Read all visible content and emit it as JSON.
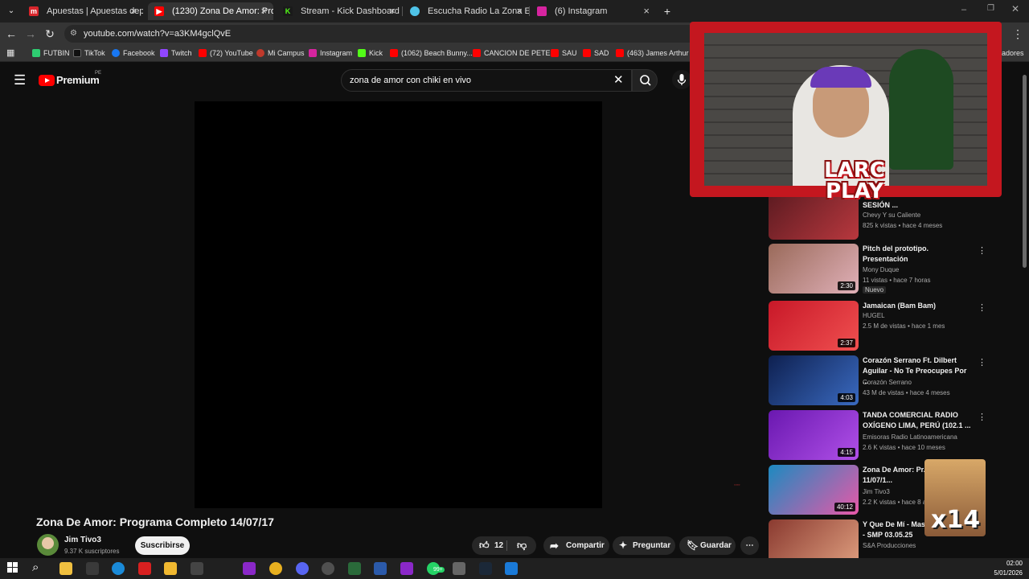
{
  "browser": {
    "tabs": [
      {
        "title": "Apuestas | Apuestas deportivas",
        "active": false,
        "icon": "m-icon"
      },
      {
        "title": "(1230) Zona De Amor: Prog",
        "active": true,
        "icon": "youtube-icon"
      },
      {
        "title": "Stream - Kick Dashboard",
        "active": false,
        "icon": "kick-icon"
      },
      {
        "title": "Escucha Radio La Zona EN VIVO",
        "active": false,
        "icon": "radio-icon"
      },
      {
        "title": "(6) Instagram",
        "active": false,
        "icon": "instagram-icon"
      }
    ],
    "url": "youtube.com/watch?v=a3KM4gclQvE",
    "bookmarks": [
      "FUTBIN",
      "TikTok",
      "Facebook",
      "Twitch",
      "(72) YouTube",
      "Mi Campus",
      "Instagram",
      "Kick",
      "(1062) Beach Bunny...",
      "CANCION DE PETER",
      "SAU",
      "SAD",
      "(463) James Arthur -..."
    ],
    "bookmarks_tail": "adores"
  },
  "youtube": {
    "logo_text": "Premium",
    "logo_region": "PE",
    "search_query": "zona de amor con chiki en vivo",
    "video_title": "Zona De Amor: Programa Completo 14/07/17",
    "channel_name": "Jim Tivo3",
    "subscribers": "9.37 K suscriptores",
    "subscribe_label": "Suscribirse",
    "likes": "12",
    "share_label": "Compartir",
    "ask_label": "Preguntar",
    "save_label": "Guardar",
    "recommendations": [
      {
        "title": "CHEVY Y SU CALIENTE / UNA SESIÓN ...",
        "channel": "Chevy Y su Caliente",
        "meta": "825 k vistas • hace 4 meses",
        "duration": "",
        "thumb": "#7a2b30"
      },
      {
        "title": "Pitch del prototipo. Presentación",
        "channel": "Mony Duque",
        "meta": "11 vistas • hace 7 horas",
        "badge": "Nuevo",
        "duration": "2:30",
        "thumb": "#b07a6a"
      },
      {
        "title": "Jamaican (Bam Bam)",
        "channel": "HUGEL",
        "meta": "2.5 M de vistas • hace 1 mes",
        "duration": "2:37",
        "thumb": "#e0283a"
      },
      {
        "title": "Corazón Serrano Ft. Dilbert Aguilar - No Te Preocupes Por ...",
        "channel": "Corazón Serrano",
        "meta": "43 M de vistas • hace 4 meses",
        "duration": "4:03",
        "thumb": "#1b3a7a"
      },
      {
        "title": "TANDA COMERCIAL RADIO OXÍGENO LIMA, PERÚ (102.1 ...",
        "channel": "Emisoras Radio Latinoamericana",
        "meta": "2.6 K vistas • hace 10 meses",
        "duration": "4:15",
        "thumb": "#8a28c8"
      },
      {
        "title": "Zona De Amor: Pr... Completo 11/07/1...",
        "channel": "Jim Tivo3",
        "meta": "2.2 K vistas • hace 8 añ...",
        "duration": "40:12",
        "thumb": "#2aa8d8"
      },
      {
        "title": "Y Que De Mí - Masiel... La Huaca - SMP 03.05.25",
        "channel": "S&A Producciones",
        "meta": "",
        "duration": "",
        "thumb": "#b85a4a"
      }
    ]
  },
  "overlay": {
    "brand_line1": "LARC",
    "brand_line2": "PLAY",
    "multiplier": "x14"
  },
  "taskbar": {
    "time": "02:00",
    "date": "5/01/2026",
    "badge": "99+"
  },
  "colors": {
    "yt_red": "#ff0000",
    "frame_red": "#c4171f",
    "bg": "#0f0f0f"
  }
}
